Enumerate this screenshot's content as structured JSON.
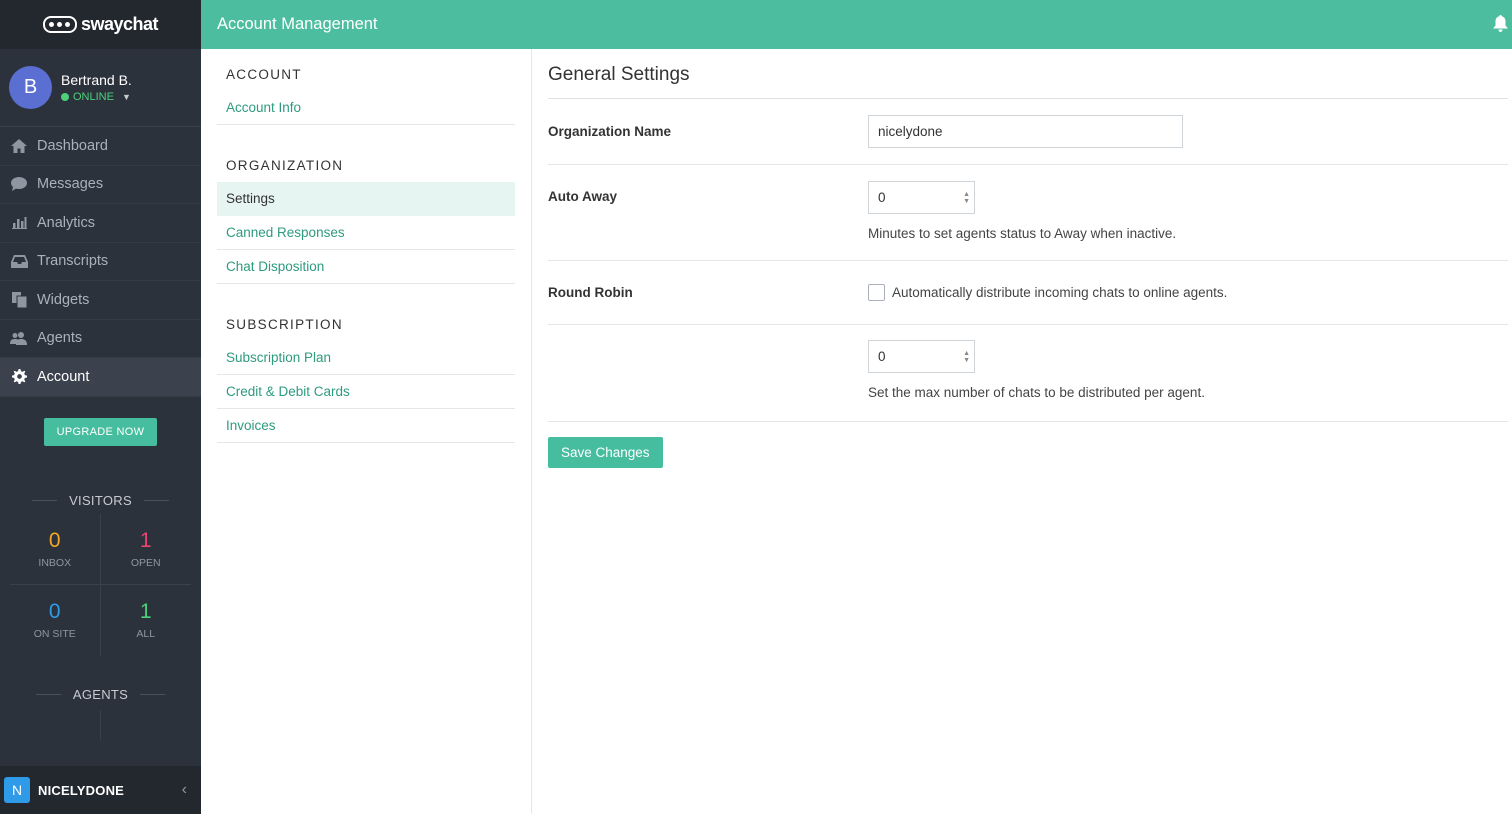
{
  "brand": {
    "logo_text": "swaychat"
  },
  "profile": {
    "initial": "B",
    "name": "Bertrand B.",
    "status": "ONLINE"
  },
  "nav": [
    {
      "label": "Dashboard",
      "icon": "home-icon"
    },
    {
      "label": "Messages",
      "icon": "chat-bubble-icon"
    },
    {
      "label": "Analytics",
      "icon": "bar-chart-icon"
    },
    {
      "label": "Transcripts",
      "icon": "inbox-tray-icon"
    },
    {
      "label": "Widgets",
      "icon": "copy-files-icon"
    },
    {
      "label": "Agents",
      "icon": "users-icon"
    },
    {
      "label": "Account",
      "icon": "gear-icon",
      "active": true
    }
  ],
  "upgrade_label": "UPGRADE NOW",
  "visitors": {
    "title": "VISITORS",
    "stats": [
      {
        "value": "0",
        "label": "INBOX",
        "color": "#f5a623"
      },
      {
        "value": "1",
        "label": "OPEN",
        "color": "#e8466f"
      },
      {
        "value": "0",
        "label": "ON SITE",
        "color": "#2f9be8"
      },
      {
        "value": "1",
        "label": "ALL",
        "color": "#4dd07a"
      }
    ]
  },
  "agents_title": "AGENTS",
  "workspace": {
    "initial": "N",
    "name": "NICELYDONE"
  },
  "topbar": {
    "title": "Account Management"
  },
  "subnav": {
    "groups": [
      {
        "heading": "ACCOUNT",
        "items": [
          "Account Info"
        ]
      },
      {
        "heading": "ORGANIZATION",
        "items": [
          "Settings",
          "Canned Responses",
          "Chat Disposition"
        ]
      },
      {
        "heading": "SUBSCRIPTION",
        "items": [
          "Subscription Plan",
          "Credit & Debit Cards",
          "Invoices"
        ]
      }
    ],
    "active": "Settings"
  },
  "settings": {
    "title": "General Settings",
    "org_name_label": "Organization Name",
    "org_name_value": "nicelydone",
    "auto_away_label": "Auto Away",
    "auto_away_value": "0",
    "auto_away_help": "Minutes to set agents status to Away when inactive.",
    "round_robin_label": "Round Robin",
    "round_robin_checkbox": "Automatically distribute incoming chats to online agents.",
    "round_robin_checked": false,
    "max_chats_value": "0",
    "max_chats_help": "Set the max number of chats to be distributed per agent.",
    "save_label": "Save Changes"
  },
  "colors": {
    "accent": "#4cbe9f",
    "sidebar": "#2c323c",
    "link": "#2e9b7e"
  }
}
